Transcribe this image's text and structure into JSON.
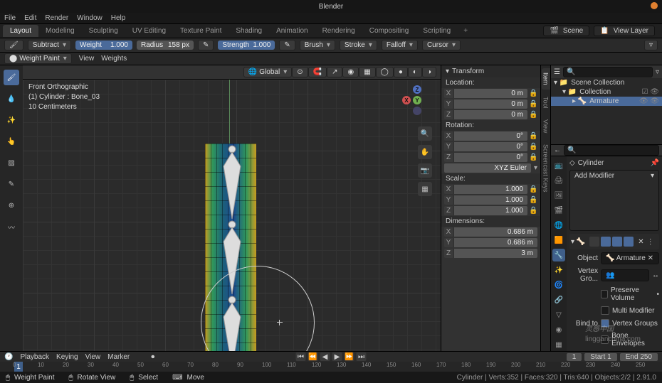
{
  "app": {
    "title": "Blender"
  },
  "menu": [
    "File",
    "Edit",
    "Render",
    "Window",
    "Help"
  ],
  "workspaces": [
    "Layout",
    "Modeling",
    "Sculpting",
    "UV Editing",
    "Texture Paint",
    "Shading",
    "Animation",
    "Rendering",
    "Compositing",
    "Scripting"
  ],
  "active_workspace": 0,
  "scene": {
    "label": "Scene",
    "viewlayer": "View Layer"
  },
  "tool_header": {
    "blend": "Subtract",
    "weight": {
      "label": "Weight",
      "value": "1.000"
    },
    "radius": {
      "label": "Radius",
      "value": "158 px"
    },
    "strength": {
      "label": "Strength",
      "value": "1.000"
    },
    "dropdowns": [
      "Brush",
      "Stroke",
      "Falloff",
      "Cursor"
    ]
  },
  "sub_header": {
    "mode": "Weight Paint",
    "menus": [
      "View",
      "Weights"
    ]
  },
  "viewport_header": {
    "orientation": "Global"
  },
  "overlay": {
    "l1": "Front Orthographic",
    "l2": "(1) Cylinder : Bone_03",
    "l3": "10 Centimeters"
  },
  "n_panel": {
    "title": "Transform",
    "location": {
      "label": "Location:",
      "x": "0 m",
      "y": "0 m",
      "z": "0 m"
    },
    "rotation": {
      "label": "Rotation:",
      "x": "0°",
      "y": "0°",
      "z": "0°",
      "mode": "XYZ Euler"
    },
    "scale": {
      "label": "Scale:",
      "x": "1.000",
      "y": "1.000",
      "z": "1.000"
    },
    "dimensions": {
      "label": "Dimensions:",
      "x": "0.686 m",
      "y": "0.686 m",
      "z": "3 m"
    },
    "tabs": [
      "Item",
      "Tool",
      "View",
      "Screencast Keys"
    ]
  },
  "outliner": {
    "root": "Scene Collection",
    "collection": "Collection",
    "items": [
      {
        "name": "Armature",
        "selected": true
      }
    ]
  },
  "properties": {
    "object_name": "Cylinder",
    "add_modifier": "Add Modifier",
    "object_label": "Object",
    "armature_field": "Armature",
    "vertex_group": "Vertex Gro...",
    "opts": {
      "preserve": "Preserve Volume",
      "preserve_on": false,
      "multi": "Multi Modifier",
      "multi_on": false
    },
    "bind": {
      "label": "Bind to",
      "vg": "Vertex Groups",
      "vg_on": true,
      "be": "Bone Envelopes",
      "be_on": false
    }
  },
  "timeline": {
    "menus": [
      "Playback",
      "Keying",
      "View",
      "Marker"
    ],
    "current": "1",
    "start_label": "Start",
    "start": "1",
    "end_label": "End",
    "end": "250",
    "ticks": [
      0,
      10,
      20,
      30,
      40,
      50,
      60,
      70,
      80,
      90,
      100,
      110,
      120,
      130,
      140,
      150,
      160,
      170,
      180,
      190,
      200,
      210,
      220,
      230,
      240,
      250
    ]
  },
  "status": {
    "mode": "Weight Paint",
    "rotate": "Rotate View",
    "select": "Select",
    "move": "Move",
    "stats": "Cylinder | Verts:352 | Faces:320 | Tris:640 | Objects:2/2 | 2.91.0"
  },
  "watermark": {
    "main": "灵感中国",
    "sub": "lingganchina.com"
  }
}
